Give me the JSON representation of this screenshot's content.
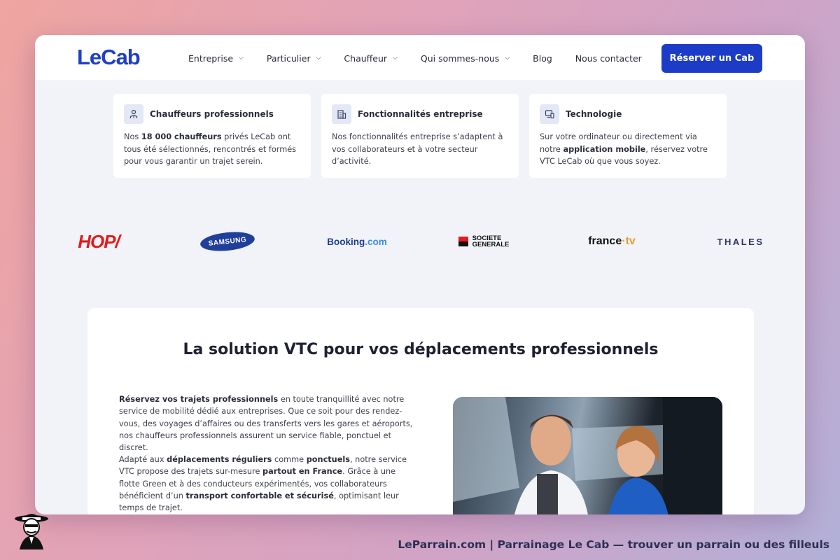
{
  "nav": {
    "logo": "LeCab",
    "items": [
      {
        "label": "Entreprise",
        "dropdown": true
      },
      {
        "label": "Particulier",
        "dropdown": true
      },
      {
        "label": "Chauffeur",
        "dropdown": true
      },
      {
        "label": "Qui sommes-nous",
        "dropdown": true
      },
      {
        "label": "Blog",
        "dropdown": false
      },
      {
        "label": "Nous contacter",
        "dropdown": false
      }
    ],
    "cta": "Réserver un Cab"
  },
  "cards": [
    {
      "icon": "driver-icon",
      "title": "Chauffeurs professionnels",
      "t1": "Nos ",
      "b1": "18 000 chauffeurs",
      "t2": " privés LeCab ont tous été sélectionnés, rencontrés et formés pour vous garantir un trajet serein."
    },
    {
      "icon": "building-icon",
      "title": "Fonctionnalités entreprise",
      "t1": "Nos fonctionnalités entreprise s’adaptent à vos collaborateurs et à votre secteur d’activité."
    },
    {
      "icon": "devices-icon",
      "title": "Technologie",
      "t1": "Sur votre ordinateur ou directement via notre ",
      "b1": "application mobile",
      "t2": ", réservez votre VTC LeCab où que vous soyez."
    }
  ],
  "clients": {
    "hop": "HOP/",
    "samsung": "SAMSUNG",
    "booking_a": "Booking",
    "booking_b": ".com",
    "sg_line1": "SOCIETE",
    "sg_line2": "GENERALE",
    "francetv_a": "france",
    "francetv_b": "·tv",
    "thales": "THALES"
  },
  "section": {
    "title": "La solution VTC pour vos déplacements professionnels",
    "p1_b1": "Réservez vos trajets professionnels",
    "p1_t1": " en toute tranquillité avec notre service de mobilité dédié aux entreprises. Que ce soit pour des rendez-vous, des voyages d’affaires ou des transferts vers les gares et aéroports, nos chauffeurs professionnels assurent un service fiable, ponctuel et discret.",
    "p2_t1": "Adapté aux ",
    "p2_b1": "déplacements réguliers",
    "p2_t2": " comme ",
    "p2_b2": "ponctuels",
    "p2_t3": ", notre service VTC propose des trajets sur-mesure ",
    "p2_b3": "partout en France",
    "p2_t4": ". Grâce à une flotte Green et à des conducteurs expérimentés, vos collaborateurs bénéficient d’un ",
    "p2_b4": "transport confortable et sécurisé",
    "p2_t5": ", optimisant leur temps de trajet."
  },
  "footer": {
    "caption": "LeParrain.com | Parrainage Le Cab — trouver un parrain ou des filleuls"
  },
  "colors": {
    "brand": "#1c3cc7",
    "hop": "#e01d1d"
  }
}
